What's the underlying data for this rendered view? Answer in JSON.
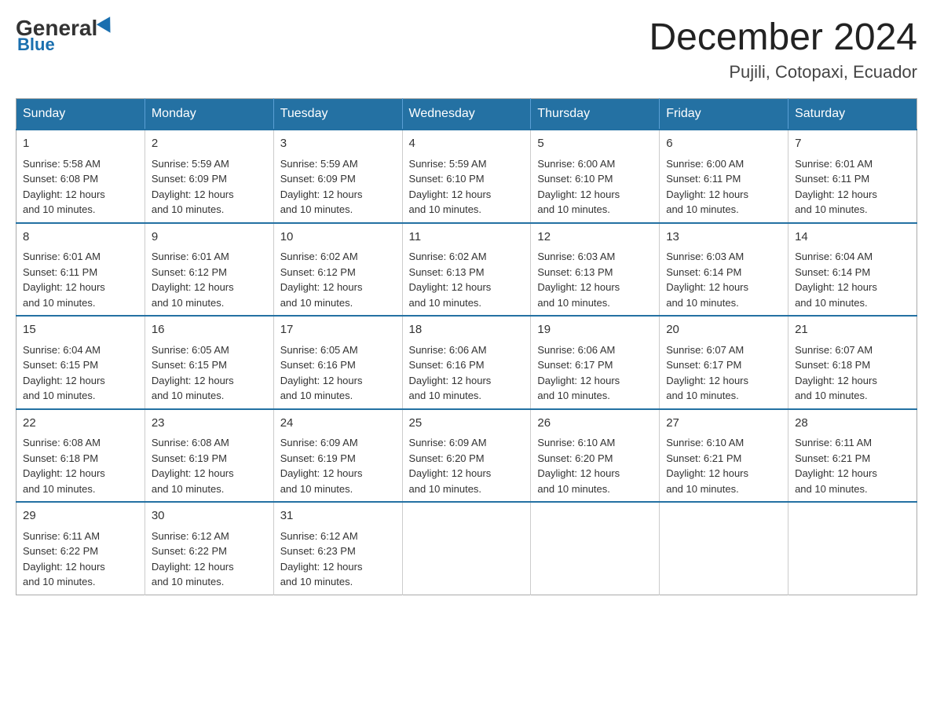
{
  "logo": {
    "general": "General",
    "blue": "Blue"
  },
  "header": {
    "month": "December 2024",
    "location": "Pujili, Cotopaxi, Ecuador"
  },
  "days_of_week": [
    "Sunday",
    "Monday",
    "Tuesday",
    "Wednesday",
    "Thursday",
    "Friday",
    "Saturday"
  ],
  "weeks": [
    [
      {
        "day": "1",
        "sunrise": "5:58 AM",
        "sunset": "6:08 PM",
        "daylight": "12 hours and 10 minutes."
      },
      {
        "day": "2",
        "sunrise": "5:59 AM",
        "sunset": "6:09 PM",
        "daylight": "12 hours and 10 minutes."
      },
      {
        "day": "3",
        "sunrise": "5:59 AM",
        "sunset": "6:09 PM",
        "daylight": "12 hours and 10 minutes."
      },
      {
        "day": "4",
        "sunrise": "5:59 AM",
        "sunset": "6:10 PM",
        "daylight": "12 hours and 10 minutes."
      },
      {
        "day": "5",
        "sunrise": "6:00 AM",
        "sunset": "6:10 PM",
        "daylight": "12 hours and 10 minutes."
      },
      {
        "day": "6",
        "sunrise": "6:00 AM",
        "sunset": "6:11 PM",
        "daylight": "12 hours and 10 minutes."
      },
      {
        "day": "7",
        "sunrise": "6:01 AM",
        "sunset": "6:11 PM",
        "daylight": "12 hours and 10 minutes."
      }
    ],
    [
      {
        "day": "8",
        "sunrise": "6:01 AM",
        "sunset": "6:11 PM",
        "daylight": "12 hours and 10 minutes."
      },
      {
        "day": "9",
        "sunrise": "6:01 AM",
        "sunset": "6:12 PM",
        "daylight": "12 hours and 10 minutes."
      },
      {
        "day": "10",
        "sunrise": "6:02 AM",
        "sunset": "6:12 PM",
        "daylight": "12 hours and 10 minutes."
      },
      {
        "day": "11",
        "sunrise": "6:02 AM",
        "sunset": "6:13 PM",
        "daylight": "12 hours and 10 minutes."
      },
      {
        "day": "12",
        "sunrise": "6:03 AM",
        "sunset": "6:13 PM",
        "daylight": "12 hours and 10 minutes."
      },
      {
        "day": "13",
        "sunrise": "6:03 AM",
        "sunset": "6:14 PM",
        "daylight": "12 hours and 10 minutes."
      },
      {
        "day": "14",
        "sunrise": "6:04 AM",
        "sunset": "6:14 PM",
        "daylight": "12 hours and 10 minutes."
      }
    ],
    [
      {
        "day": "15",
        "sunrise": "6:04 AM",
        "sunset": "6:15 PM",
        "daylight": "12 hours and 10 minutes."
      },
      {
        "day": "16",
        "sunrise": "6:05 AM",
        "sunset": "6:15 PM",
        "daylight": "12 hours and 10 minutes."
      },
      {
        "day": "17",
        "sunrise": "6:05 AM",
        "sunset": "6:16 PM",
        "daylight": "12 hours and 10 minutes."
      },
      {
        "day": "18",
        "sunrise": "6:06 AM",
        "sunset": "6:16 PM",
        "daylight": "12 hours and 10 minutes."
      },
      {
        "day": "19",
        "sunrise": "6:06 AM",
        "sunset": "6:17 PM",
        "daylight": "12 hours and 10 minutes."
      },
      {
        "day": "20",
        "sunrise": "6:07 AM",
        "sunset": "6:17 PM",
        "daylight": "12 hours and 10 minutes."
      },
      {
        "day": "21",
        "sunrise": "6:07 AM",
        "sunset": "6:18 PM",
        "daylight": "12 hours and 10 minutes."
      }
    ],
    [
      {
        "day": "22",
        "sunrise": "6:08 AM",
        "sunset": "6:18 PM",
        "daylight": "12 hours and 10 minutes."
      },
      {
        "day": "23",
        "sunrise": "6:08 AM",
        "sunset": "6:19 PM",
        "daylight": "12 hours and 10 minutes."
      },
      {
        "day": "24",
        "sunrise": "6:09 AM",
        "sunset": "6:19 PM",
        "daylight": "12 hours and 10 minutes."
      },
      {
        "day": "25",
        "sunrise": "6:09 AM",
        "sunset": "6:20 PM",
        "daylight": "12 hours and 10 minutes."
      },
      {
        "day": "26",
        "sunrise": "6:10 AM",
        "sunset": "6:20 PM",
        "daylight": "12 hours and 10 minutes."
      },
      {
        "day": "27",
        "sunrise": "6:10 AM",
        "sunset": "6:21 PM",
        "daylight": "12 hours and 10 minutes."
      },
      {
        "day": "28",
        "sunrise": "6:11 AM",
        "sunset": "6:21 PM",
        "daylight": "12 hours and 10 minutes."
      }
    ],
    [
      {
        "day": "29",
        "sunrise": "6:11 AM",
        "sunset": "6:22 PM",
        "daylight": "12 hours and 10 minutes."
      },
      {
        "day": "30",
        "sunrise": "6:12 AM",
        "sunset": "6:22 PM",
        "daylight": "12 hours and 10 minutes."
      },
      {
        "day": "31",
        "sunrise": "6:12 AM",
        "sunset": "6:23 PM",
        "daylight": "12 hours and 10 minutes."
      },
      null,
      null,
      null,
      null
    ]
  ],
  "labels": {
    "sunrise": "Sunrise:",
    "sunset": "Sunset:",
    "daylight": "Daylight:"
  }
}
